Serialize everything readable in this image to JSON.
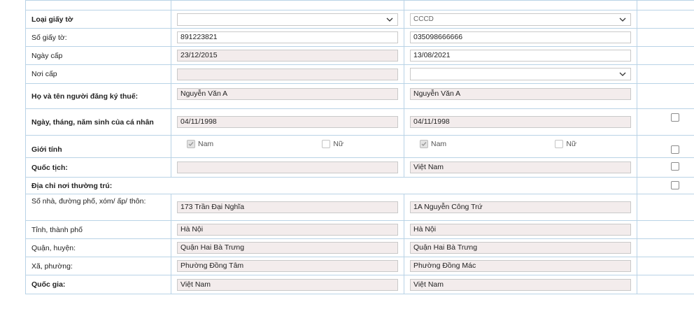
{
  "rows": {
    "loai_giay_to": {
      "label": "Loại giấy tờ",
      "col1": "",
      "col2": "CCCD"
    },
    "so_giay_to": {
      "label": "Số giấy tờ:",
      "col1": "891223821",
      "col2": "035098666666"
    },
    "ngay_cap": {
      "label": "Ngày cấp",
      "col1": "23/12/2015",
      "col2": "13/08/2021"
    },
    "noi_cap": {
      "label": "Nơi cấp",
      "col1": "",
      "col2": ""
    },
    "ho_ten": {
      "label": "Họ và tên người đăng ký thuế:",
      "col1": "Nguyễn Văn A",
      "col2": "Nguyễn Văn A"
    },
    "ngay_sinh": {
      "label": "Ngày, tháng, năm sinh của cá nhân",
      "col1": "04/11/1998",
      "col2": "04/11/1998"
    },
    "gioi_tinh": {
      "label": "Giới tính",
      "nam": "Nam",
      "nu": "Nữ"
    },
    "quoc_tich": {
      "label": "Quốc tịch:",
      "col1": "",
      "col2": "Việt Nam"
    },
    "dia_chi": {
      "label": "Địa chỉ nơi thường trú:"
    },
    "so_nha": {
      "label": "Số nhà, đường phố, xóm/ ấp/ thôn:",
      "col1": "173 Trần Đại Nghĩa",
      "col2": "1A Nguyễn Công Trứ"
    },
    "tinh": {
      "label": "Tỉnh, thành phố",
      "col1": "Hà Nội",
      "col2": "Hà Nội"
    },
    "quan": {
      "label": "Quận, huyện:",
      "col1": "Quận Hai Bà Trưng",
      "col2": "Quận Hai Bà Trưng"
    },
    "xa": {
      "label": "Xã, phường:",
      "col1": "Phường Đồng Tâm",
      "col2": "Phường Đồng Mác"
    },
    "quoc_gia": {
      "label": "Quốc gia:",
      "col1": "Việt Nam",
      "col2": "Việt Nam"
    }
  },
  "gender_col1": {
    "nam_checked": true,
    "nu_checked": false
  },
  "gender_col2": {
    "nam_checked": true,
    "nu_checked": false
  },
  "colors": {
    "border": "#b9d3e6",
    "readonly_bg": "#f3ecec"
  }
}
